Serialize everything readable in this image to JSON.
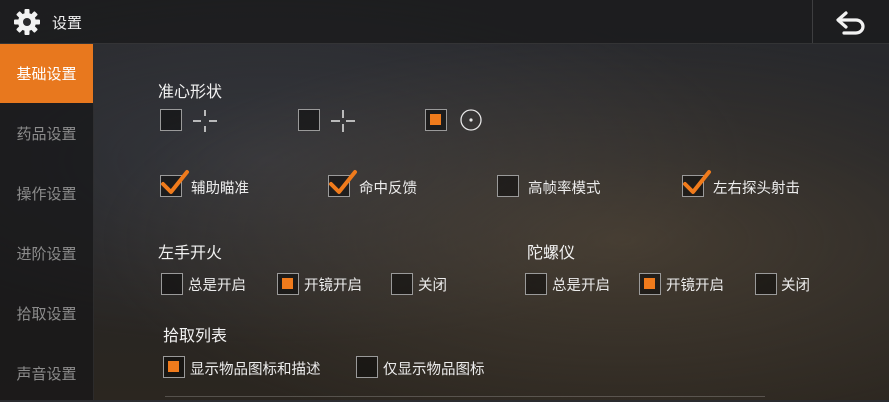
{
  "header": {
    "title": "设置",
    "icons": {
      "settings": "gear-icon",
      "back": "return-arrow-icon"
    }
  },
  "sidebar": {
    "items": [
      {
        "label": "基础设置",
        "active": true
      },
      {
        "label": "药品设置",
        "active": false
      },
      {
        "label": "操作设置",
        "active": false
      },
      {
        "label": "进阶设置",
        "active": false
      },
      {
        "label": "拾取设置",
        "active": false
      },
      {
        "label": "声音设置",
        "active": false
      }
    ]
  },
  "crosshair": {
    "title": "准心形状",
    "options": [
      {
        "icon": "crosshair-gap-icon",
        "selected": false
      },
      {
        "icon": "crosshair-plus-icon",
        "selected": false
      },
      {
        "icon": "crosshair-dot-circle-icon",
        "selected": true
      }
    ]
  },
  "toggles": [
    {
      "label": "辅助瞄准",
      "checked": true
    },
    {
      "label": "命中反馈",
      "checked": true
    },
    {
      "label": "高帧率模式",
      "checked": false
    },
    {
      "label": "左右探头射击",
      "checked": true
    }
  ],
  "left_fire": {
    "title": "左手开火",
    "options": [
      {
        "label": "总是开启",
        "selected": false
      },
      {
        "label": "开镜开启",
        "selected": true
      },
      {
        "label": "关闭",
        "selected": false
      }
    ]
  },
  "gyroscope": {
    "title": "陀螺仪",
    "options": [
      {
        "label": "总是开启",
        "selected": false
      },
      {
        "label": "开镜开启",
        "selected": true
      },
      {
        "label": "关闭",
        "selected": false
      }
    ]
  },
  "pickup_list": {
    "title": "拾取列表",
    "options": [
      {
        "label": "显示物品图标和描述",
        "selected": true
      },
      {
        "label": "仅显示物品图标",
        "selected": false
      }
    ]
  },
  "colors": {
    "accent": "#e8781e",
    "check": "#f07b1c"
  }
}
